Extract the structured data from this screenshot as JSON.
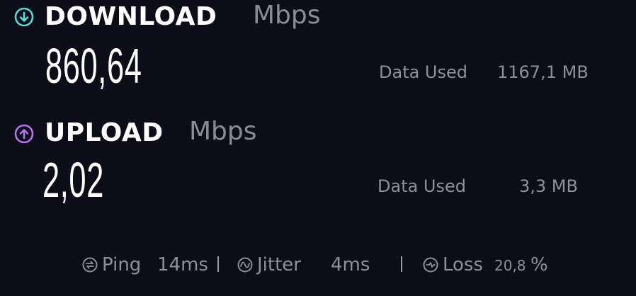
{
  "download": {
    "title": "DOWNLOAD",
    "unit": "Mbps",
    "value": "860,64",
    "data_used_label": "Data Used",
    "data_used_value": "1167,1 MB",
    "icon": "arrow-down-circle-icon",
    "accent": "#5ad8d5"
  },
  "upload": {
    "title": "UPLOAD",
    "unit": "Mbps",
    "value": "2,02",
    "data_used_label": "Data Used",
    "data_used_value": "3,3 MB",
    "icon": "arrow-up-circle-icon",
    "accent": "#b874f0"
  },
  "stats": {
    "ping_label": "Ping",
    "ping_value": "14ms",
    "jitter_label": "Jitter",
    "jitter_value": "4ms",
    "loss_label": "Loss",
    "loss_value": "20,8",
    "loss_unit": "%",
    "separator": "|"
  },
  "colors": {
    "background": "#0d0d1a",
    "text": "#ffffff",
    "muted": "#8d8f99"
  }
}
